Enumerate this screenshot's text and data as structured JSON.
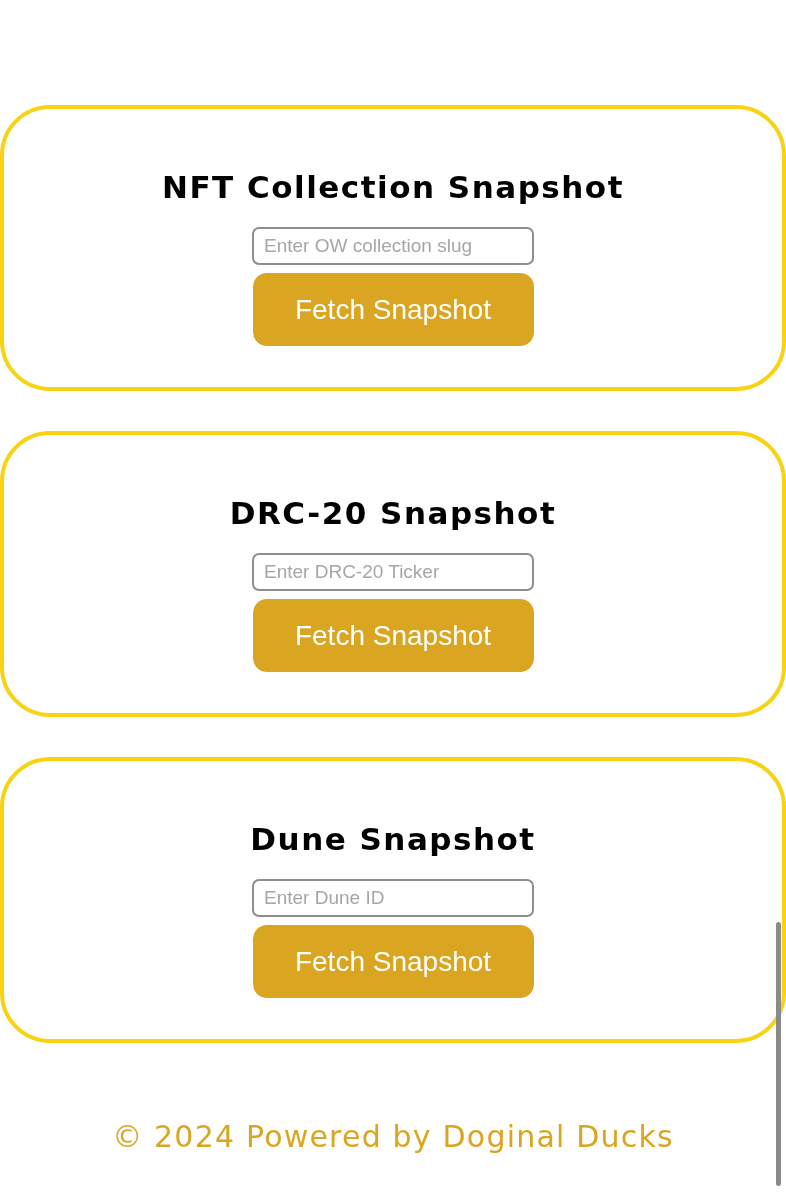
{
  "sections": [
    {
      "title": "NFT Collection Snapshot",
      "input": {
        "placeholder": "Enter OW collection slug"
      },
      "button": "Fetch Snapshot"
    },
    {
      "title": "DRC-20 Snapshot",
      "input": {
        "placeholder": "Enter DRC-20 Ticker"
      },
      "button": "Fetch Snapshot"
    },
    {
      "title": "Dune Snapshot",
      "input": {
        "placeholder": "Enter Dune ID"
      },
      "button": "Fetch Snapshot"
    }
  ],
  "footer": "© 2024 Powered by Doginal Ducks"
}
